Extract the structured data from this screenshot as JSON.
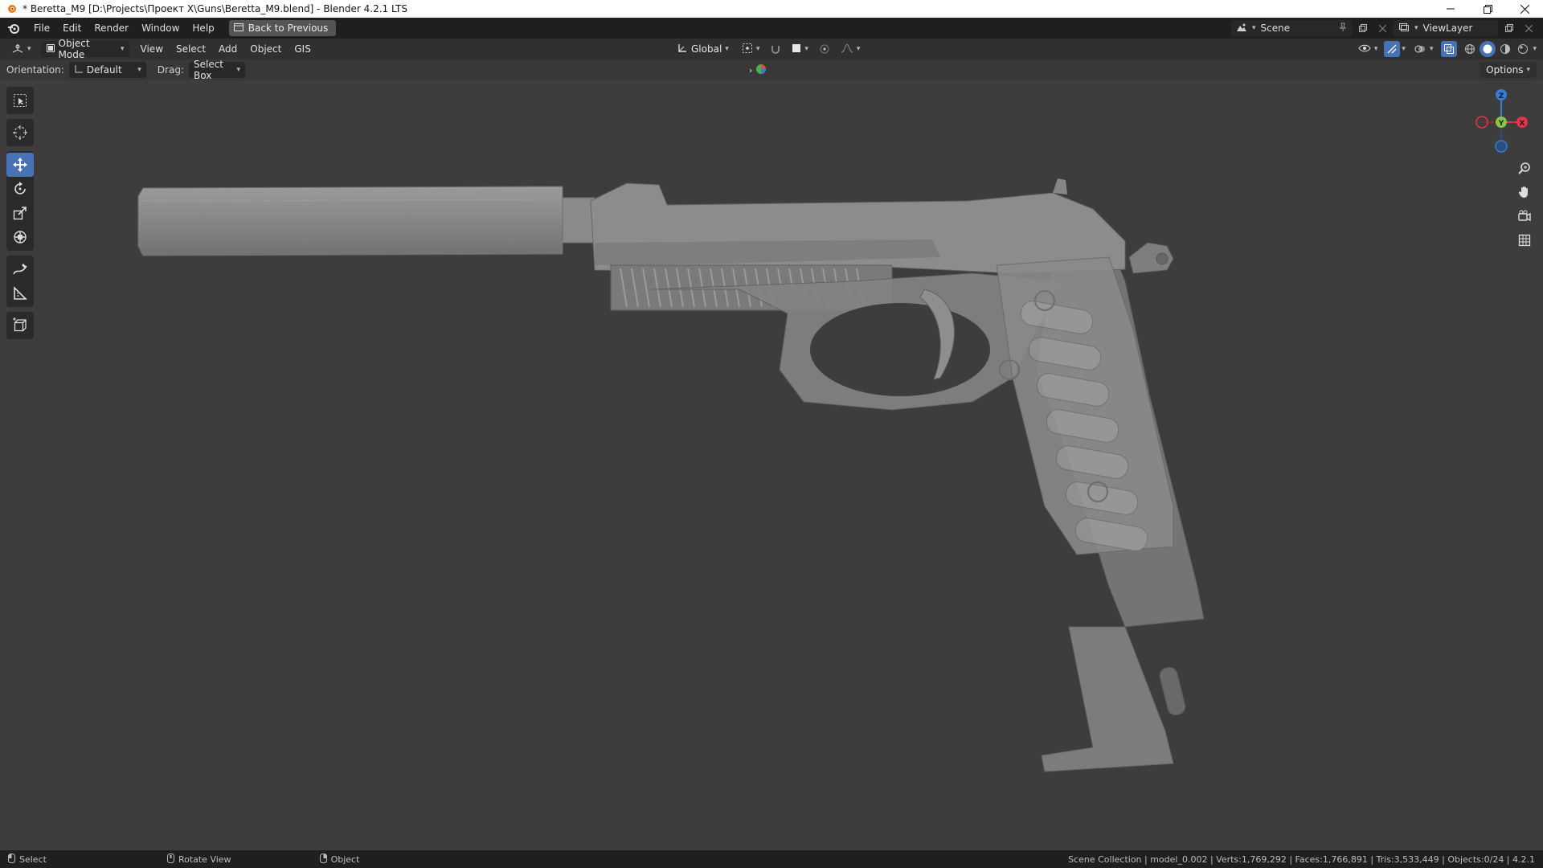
{
  "window": {
    "title": "* Beretta_M9 [D:\\Projects\\Проект X\\Guns\\Beretta_M9.blend] - Blender 4.2.1 LTS",
    "minimize_icon": "minimize-icon",
    "maximize_icon": "restore-icon",
    "close_icon": "close-icon"
  },
  "menu": {
    "items": [
      "File",
      "Edit",
      "Render",
      "Window",
      "Help"
    ],
    "back_button": "Back to Previous",
    "scene": "Scene",
    "view_layer": "ViewLayer"
  },
  "viewport_header": {
    "mode": "Object Mode",
    "menus": [
      "View",
      "Select",
      "Add",
      "Object",
      "GIS"
    ],
    "transform_orientation": "Global"
  },
  "tool_settings": {
    "orientation_label": "Orientation:",
    "orientation_value": "Default",
    "drag_label": "Drag:",
    "drag_value": "Select Box",
    "options": "Options"
  },
  "toolbar": {
    "tools": [
      "select-box",
      "cursor",
      "move",
      "rotate",
      "scale",
      "transform",
      "annotate",
      "measure",
      "add-cube"
    ],
    "active_tool": "move"
  },
  "gizmo": {
    "axes": [
      "Z",
      "Y",
      "X"
    ],
    "colors": {
      "x": "#e2344d",
      "y": "#8bc34a",
      "z": "#3a7bd5"
    }
  },
  "status": {
    "left": [
      "Select",
      "Rotate View",
      "Object"
    ],
    "right": "Scene Collection | model_0.002 | Verts:1,769,292 | Faces:1,766,891 | Tris:3,533,449 | Objects:0/24 | 4.2.1"
  },
  "colors": {
    "accent": "#4772b3",
    "viewport_bg": "#3d3d3d",
    "model": "#8a8a8a"
  }
}
